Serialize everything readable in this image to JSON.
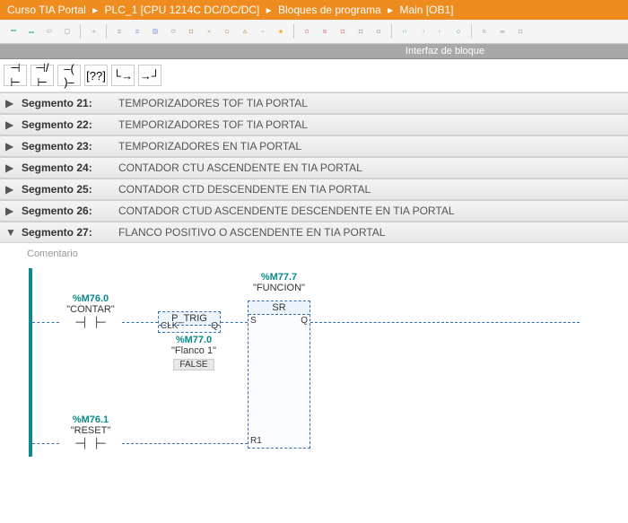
{
  "breadcrumb": {
    "part1": "Curso TIA Portal",
    "part2": "PLC_1 [CPU 1214C DC/DC/DC]",
    "part3": "Bloques de programa",
    "part4": "Main [OB1]"
  },
  "interface_bar": "Interfaz de bloque",
  "lad_toolbar": {
    "nc": "⊣⊢",
    "no": "⊣/⊢",
    "coil": "⊣ ⊢",
    "box": "??",
    "branch_open": "⊢",
    "branch_close": "⊣"
  },
  "segments": [
    {
      "num": "Segmento 21:",
      "desc": "TEMPORIZADORES TOF TIA PORTAL"
    },
    {
      "num": "Segmento 22:",
      "desc": "TEMPORIZADORES TOF TIA PORTAL"
    },
    {
      "num": "Segmento 23:",
      "desc": "TEMPORIZADORES EN TIA PORTAL"
    },
    {
      "num": "Segmento 24:",
      "desc": "CONTADOR CTU ASCENDENTE EN TIA PORTAL"
    },
    {
      "num": "Segmento 25:",
      "desc": "CONTADOR CTD DESCENDENTE EN TIA PORTAL"
    },
    {
      "num": "Segmento 26:",
      "desc": "CONTADOR CTUD ASCENDENTE DESCENDENTE EN TIA PORTAL"
    },
    {
      "num": "Segmento 27:",
      "desc": "FLANCO POSITIVO O ASCENDENTE EN TIA PORTAL"
    }
  ],
  "expanded": {
    "comment_label": "Comentario",
    "contact1": {
      "addr": "%M76.0",
      "name": "\"CONTAR\""
    },
    "contact2": {
      "addr": "%M76.1",
      "name": "\"RESET\""
    },
    "ptrig": {
      "title": "P_TRIG",
      "clk": "CLK",
      "q": "Q",
      "mem_addr": "%M77.0",
      "mem_name": "\"Flanco 1\"",
      "state": "FALSE"
    },
    "sr": {
      "title": "SR",
      "addr": "%M77.7",
      "name": "\"FUNCION\"",
      "s": "S",
      "r1": "R1",
      "q": "Q"
    }
  },
  "chart_data": {
    "type": "ladder",
    "rungs": [
      {
        "contacts": [
          {
            "type": "NO",
            "address": "%M76.0",
            "symbol": "CONTAR"
          }
        ],
        "function_blocks": [
          {
            "type": "P_TRIG",
            "pins": {
              "CLK": "in",
              "Q": "out"
            },
            "memory": {
              "address": "%M77.0",
              "symbol": "Flanco 1",
              "live_value": "FALSE"
            }
          },
          {
            "type": "SR",
            "instance": {
              "address": "%M77.7",
              "symbol": "FUNCION"
            },
            "pins": {
              "S": "in",
              "R1": "in",
              "Q": "out"
            }
          }
        ]
      },
      {
        "contacts": [
          {
            "type": "NO",
            "address": "%M76.1",
            "symbol": "RESET",
            "target_pin": "R1"
          }
        ]
      }
    ]
  }
}
